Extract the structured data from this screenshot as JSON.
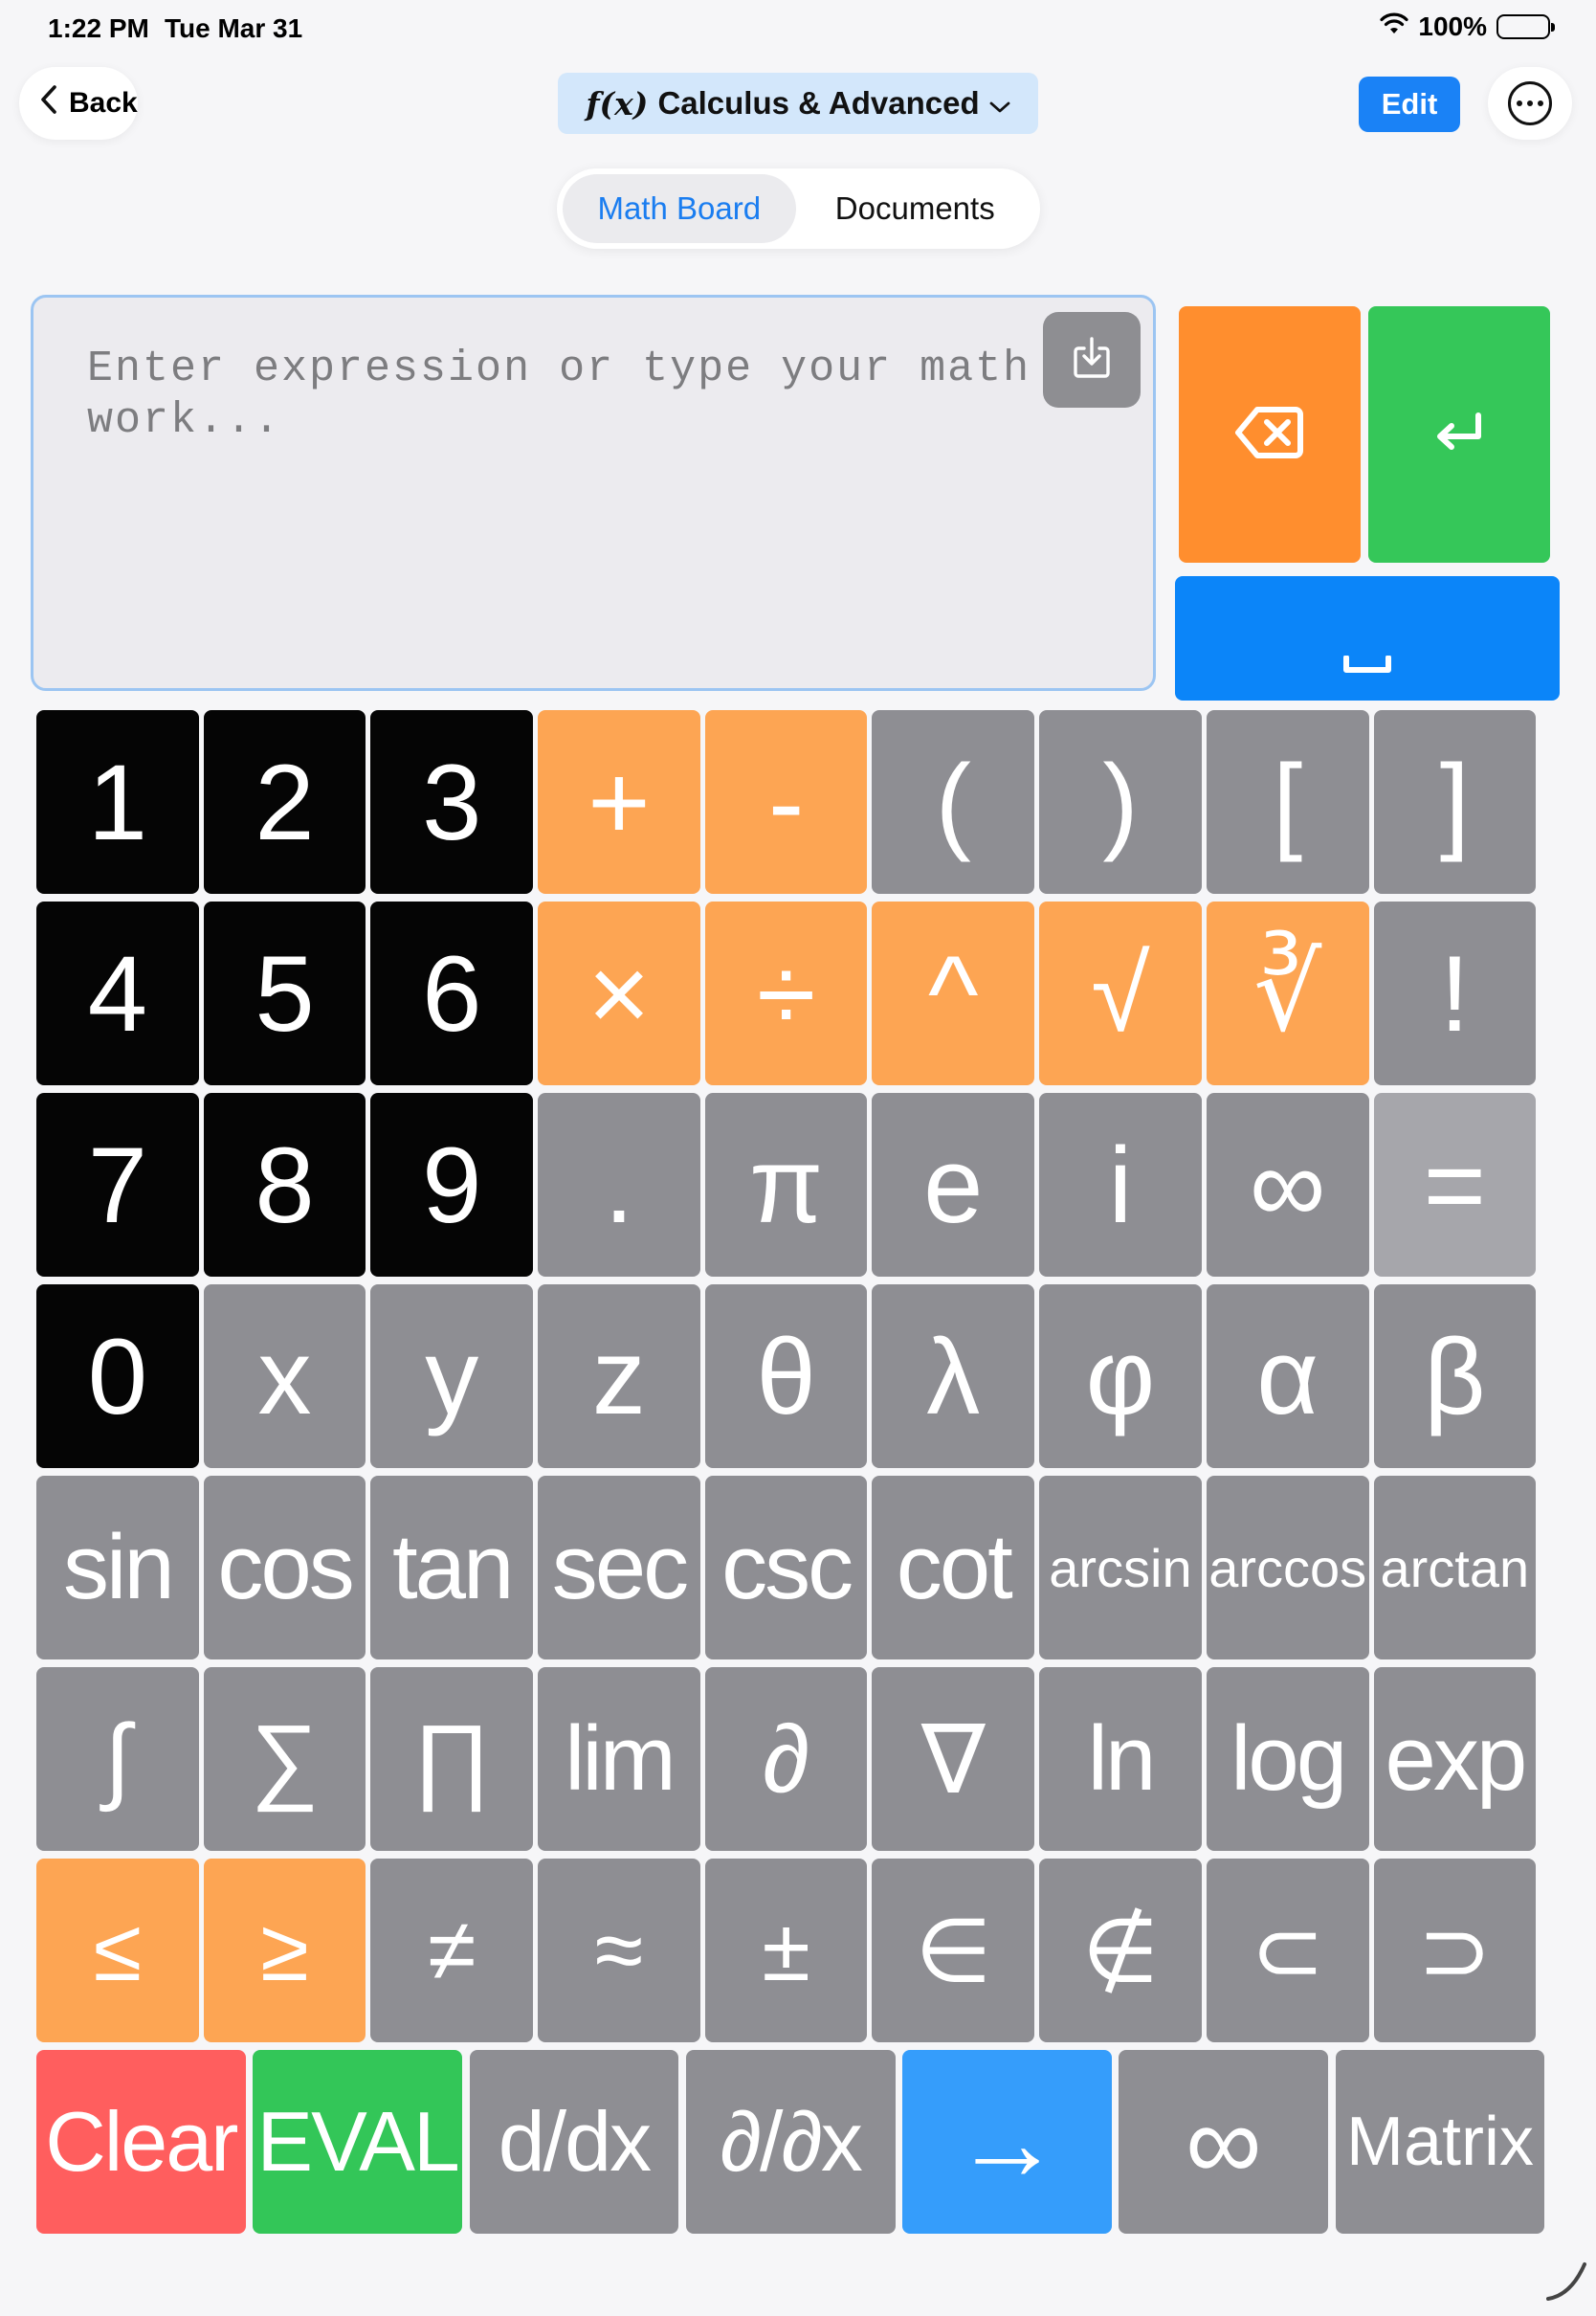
{
  "status_bar": {
    "time": "1:22 PM",
    "date": "Tue Mar 31",
    "battery": "100%"
  },
  "nav": {
    "back_label": "Back",
    "title_prefix": "f(x)",
    "title": "Calculus & Advanced",
    "edit_label": "Edit"
  },
  "tabs": [
    {
      "label": "Math Board",
      "active": true
    },
    {
      "label": "Documents",
      "active": false
    }
  ],
  "input": {
    "placeholder": "Enter expression or type your math work...",
    "value": ""
  },
  "keypad": {
    "rows": [
      [
        "1",
        "2",
        "3",
        "+",
        "-",
        "(",
        ")",
        "[",
        "]"
      ],
      [
        "4",
        "5",
        "6",
        "×",
        "÷",
        "^",
        "√",
        "∛",
        "!"
      ],
      [
        "7",
        "8",
        "9",
        ".",
        "π",
        "e",
        "i",
        "∞",
        "="
      ],
      [
        "0",
        "x",
        "y",
        "z",
        "θ",
        "λ",
        "φ",
        "α",
        "β"
      ],
      [
        "sin",
        "cos",
        "tan",
        "sec",
        "csc",
        "cot",
        "arcsin",
        "arccos",
        "arctan"
      ],
      [
        "∫",
        "∑",
        "∏",
        "lim",
        "∂",
        "∇",
        "ln",
        "log",
        "exp"
      ],
      [
        "≤",
        "≥",
        "≠",
        "≈",
        "±",
        "∈",
        "∉",
        "⊂",
        "⊃"
      ]
    ],
    "bottom_row": [
      "Clear",
      "EVAL",
      "d/dx",
      "∂/∂x",
      "→",
      "∞",
      "Matrix"
    ]
  },
  "colors": {
    "number_key": "#050505",
    "operator_key": "#fda553",
    "function_key": "#8e8e93",
    "delete_key": "#ff8e2e",
    "return_key": "#35c759",
    "space_key": "#0b85f9",
    "clear_key": "#ff5e5e",
    "eval_key": "#33c658",
    "arrow_key": "#359dfb",
    "accent": "#1a82f6"
  },
  "icons": {
    "back": "chevron-left-icon",
    "dropdown": "chevron-down-icon",
    "more": "ellipsis-circle-icon",
    "paste": "tray-arrow-down-icon",
    "delete": "delete-left-icon",
    "return": "return-icon",
    "space": "space-icon"
  }
}
